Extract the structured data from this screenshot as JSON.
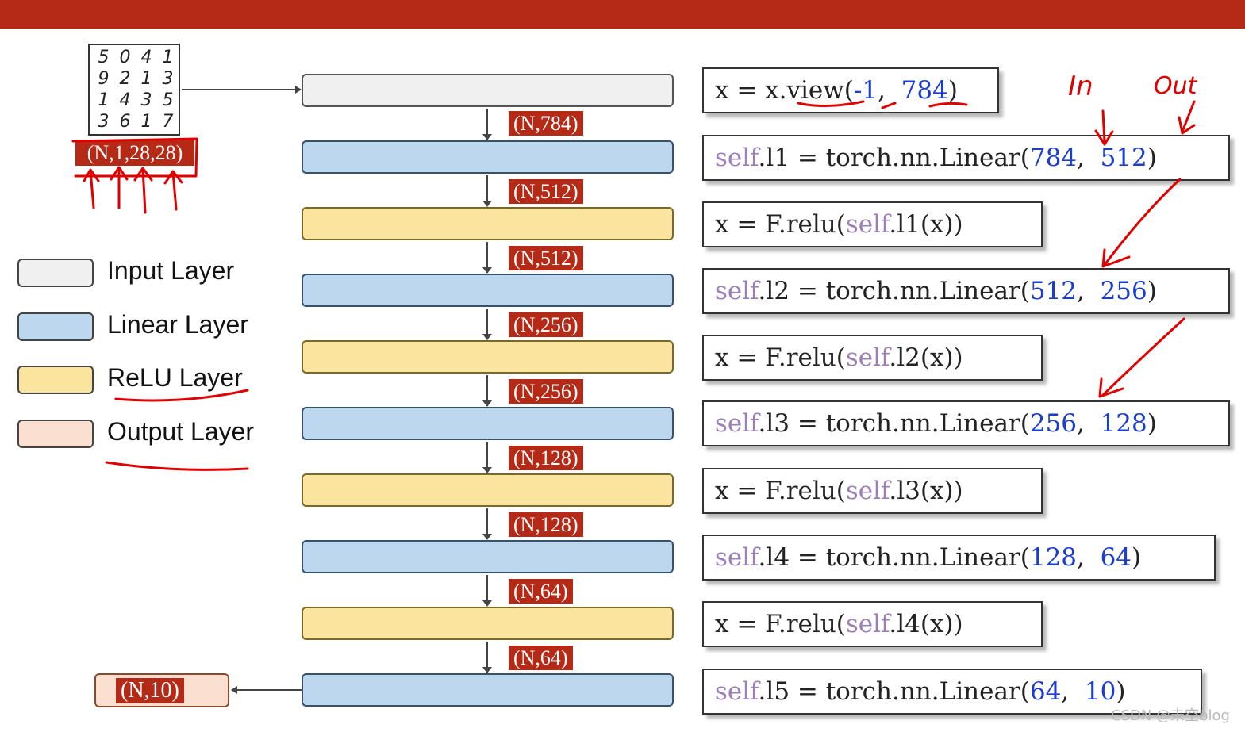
{
  "input_image": {
    "digits": [
      [
        "5",
        "0",
        "4",
        "1"
      ],
      [
        "9",
        "2",
        "1",
        "3"
      ],
      [
        "1",
        "4",
        "3",
        "5"
      ],
      [
        "3",
        "6",
        "1",
        "7"
      ]
    ],
    "shape": "(N,1,28,28)"
  },
  "layer_shapes": [
    "(N,784)",
    "(N,512)",
    "(N,512)",
    "(N,256)",
    "(N,256)",
    "(N,128)",
    "(N,128)",
    "(N,64)",
    "(N,64)"
  ],
  "output_shape": "(N,10)",
  "legend": [
    {
      "label": "Input Layer",
      "color": "#f0f0f0"
    },
    {
      "label": "Linear Layer",
      "color": "#bdd7ee"
    },
    {
      "label": "ReLU Layer",
      "color": "#fbe49e"
    },
    {
      "label": "Output Layer",
      "color": "#fbe0d2"
    }
  ],
  "code": {
    "view": {
      "prefix": "x = x.view(",
      "a": "-1",
      "sep": ",  ",
      "b": "784",
      "suffix": ")"
    },
    "l1": {
      "self": "self",
      "mid": ".l1 = torch.nn.Linear(",
      "a": "784",
      "sep": ",  ",
      "b": "512",
      "suffix": ")"
    },
    "r1": {
      "prefix": "x = F.relu(",
      "self": "self",
      "suffix": ".l1(x))"
    },
    "l2": {
      "self": "self",
      "mid": ".l2 = torch.nn.Linear(",
      "a": "512",
      "sep": ",  ",
      "b": "256",
      "suffix": ")"
    },
    "r2": {
      "prefix": "x = F.relu(",
      "self": "self",
      "suffix": ".l2(x))"
    },
    "l3": {
      "self": "self",
      "mid": ".l3 = torch.nn.Linear(",
      "a": "256",
      "sep": ",  ",
      "b": "128",
      "suffix": ")"
    },
    "r3": {
      "prefix": "x = F.relu(",
      "self": "self",
      "suffix": ".l3(x))"
    },
    "l4": {
      "self": "self",
      "mid": ".l4 = torch.nn.Linear(",
      "a": "128",
      "sep": ",  ",
      "b": "64",
      "suffix": ")"
    },
    "r4": {
      "prefix": "x = F.relu(",
      "self": "self",
      "suffix": ".l4(x))"
    },
    "l5": {
      "self": "self",
      "mid": ".l5 = torch.nn.Linear(",
      "a": "64",
      "sep": ",  ",
      "b": "10",
      "suffix": ")"
    }
  },
  "annotations": {
    "in": "In",
    "out": "Out"
  },
  "watermark": "CSDN @未空blog",
  "colors": {
    "accent": "#b52a16",
    "number": "#1a3dd0",
    "keyword": "#9b7fb6",
    "handwriting": "#e00000"
  }
}
